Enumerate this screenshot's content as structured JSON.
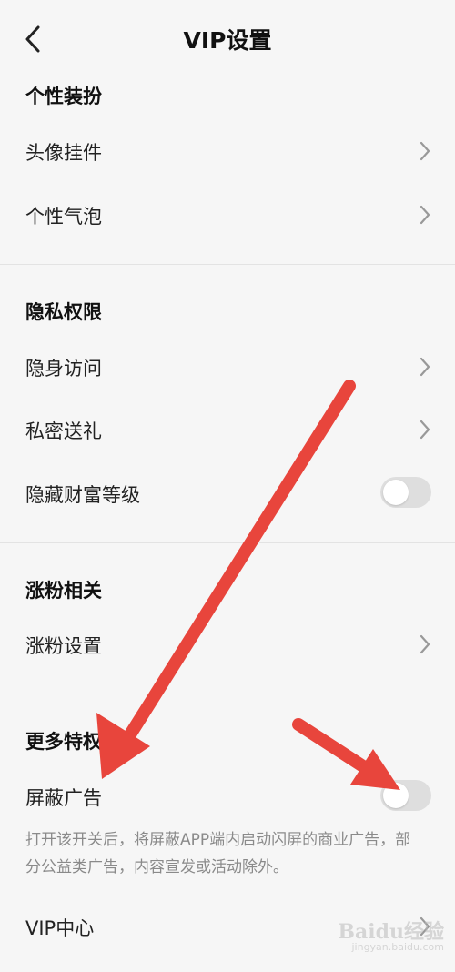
{
  "header": {
    "title": "VIP设置"
  },
  "sections": {
    "personal": {
      "title": "个性装扮",
      "avatar_pendant": "头像挂件",
      "bubble": "个性气泡"
    },
    "privacy": {
      "title": "隐私权限",
      "invisible_visit": "隐身访问",
      "private_gift": "私密送礼",
      "hide_wealth": "隐藏财富等级",
      "hide_wealth_on": false
    },
    "fans": {
      "title": "涨粉相关",
      "fans_settings": "涨粉设置"
    },
    "more": {
      "title": "更多特权",
      "block_ads": "屏蔽广告",
      "block_ads_on": false,
      "block_ads_desc": "打开该开关后，将屏蔽APP端内启动闪屏的商业广告，部分公益类广告，内容宣发或活动除外。",
      "vip_center": "VIP中心"
    }
  },
  "watermark": {
    "main": "Baidu经验",
    "sub": "jingyan.baidu.com"
  },
  "colors": {
    "annotation_arrow": "#e8453c",
    "toggle_off": "#dedede",
    "background": "#f6f6f6"
  }
}
